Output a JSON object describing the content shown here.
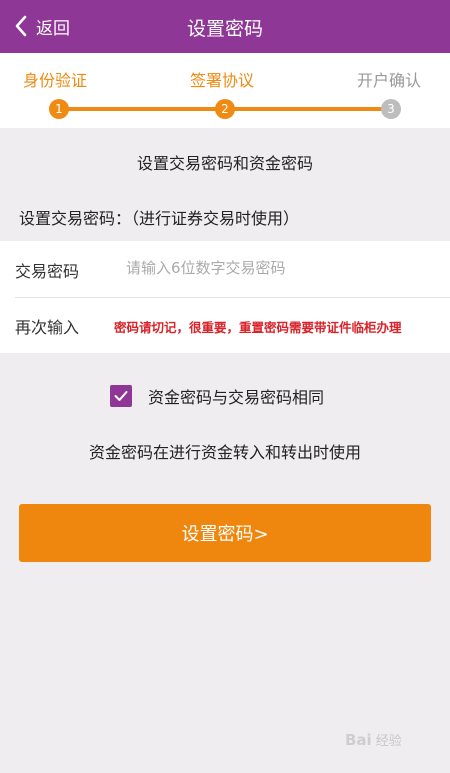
{
  "header": {
    "back_label": "返回",
    "title": "设置密码"
  },
  "steps": {
    "items": [
      {
        "label": "身份验证",
        "number": "1",
        "state": "done"
      },
      {
        "label": "签署协议",
        "number": "2",
        "state": "current"
      },
      {
        "label": "开户确认",
        "number": "3",
        "state": "pending"
      }
    ],
    "active_color": "#ef8a12",
    "inactive_color": "#bdbdbd"
  },
  "section": {
    "title": "设置交易密码和资金密码",
    "subtitle": "设置交易密码：（进行证券交易时使用）"
  },
  "form": {
    "password_label": "交易密码",
    "password_placeholder": "请输入6位数字交易密码",
    "confirm_label": "再次输入",
    "warning": "密码请切记，很重要，重置密码需要带证件临柜办理"
  },
  "checkbox": {
    "label": "资金密码与交易密码相同",
    "checked": true
  },
  "note": "资金密码在进行资金转入和转出时使用",
  "submit_label": "设置密码>",
  "watermark": {
    "logo": "Bai",
    "text": "经验"
  },
  "colors": {
    "header": "#8e3796",
    "accent": "#ef870e",
    "warning": "#d8232a"
  }
}
